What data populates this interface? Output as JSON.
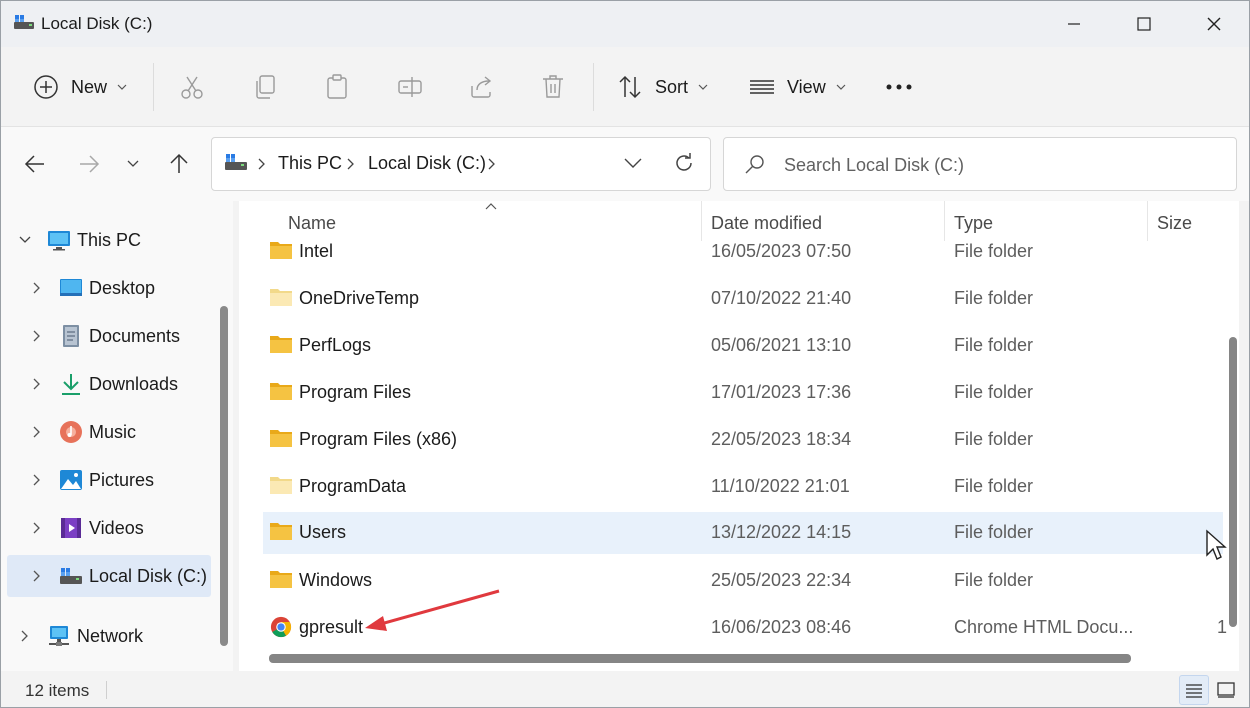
{
  "window": {
    "title": "Local Disk (C:)"
  },
  "toolbar": {
    "new_label": "New",
    "sort_label": "Sort",
    "view_label": "View"
  },
  "address": {
    "crumbs": [
      "This PC",
      "Local Disk (C:)"
    ]
  },
  "search": {
    "placeholder": "Search Local Disk (C:)"
  },
  "sidebar": {
    "items": [
      {
        "label": "This PC",
        "icon": "computer-icon"
      },
      {
        "label": "Desktop",
        "icon": "desktop-icon"
      },
      {
        "label": "Documents",
        "icon": "documents-icon"
      },
      {
        "label": "Downloads",
        "icon": "download-icon"
      },
      {
        "label": "Music",
        "icon": "music-icon"
      },
      {
        "label": "Pictures",
        "icon": "pictures-icon"
      },
      {
        "label": "Videos",
        "icon": "videos-icon"
      },
      {
        "label": "Local Disk (C:)",
        "icon": "drive-icon"
      },
      {
        "label": "Network",
        "icon": "network-icon"
      }
    ]
  },
  "table": {
    "columns": {
      "name": "Name",
      "date": "Date modified",
      "type": "Type",
      "size": "Size"
    },
    "rows": [
      {
        "name": "Intel",
        "date": "16/05/2023 07:50",
        "type": "File folder",
        "size": ""
      },
      {
        "name": "OneDriveTemp",
        "date": "07/10/2022 21:40",
        "type": "File folder",
        "size": ""
      },
      {
        "name": "PerfLogs",
        "date": "05/06/2021 13:10",
        "type": "File folder",
        "size": ""
      },
      {
        "name": "Program Files",
        "date": "17/01/2023 17:36",
        "type": "File folder",
        "size": ""
      },
      {
        "name": "Program Files (x86)",
        "date": "22/05/2023 18:34",
        "type": "File folder",
        "size": ""
      },
      {
        "name": "ProgramData",
        "date": "11/10/2022 21:01",
        "type": "File folder",
        "size": ""
      },
      {
        "name": "Users",
        "date": "13/12/2022 14:15",
        "type": "File folder",
        "size": ""
      },
      {
        "name": "Windows",
        "date": "25/05/2023 22:34",
        "type": "File folder",
        "size": ""
      },
      {
        "name": "gpresult",
        "date": "16/06/2023 08:46",
        "type": "Chrome HTML Docu...",
        "size": "1"
      }
    ]
  },
  "status": {
    "item_count": "12 items"
  },
  "colors": {
    "folder": "#f5c342",
    "accent": "#0067c0",
    "annotation_arrow": "#e0393e",
    "selection": "#dfe9f7"
  }
}
